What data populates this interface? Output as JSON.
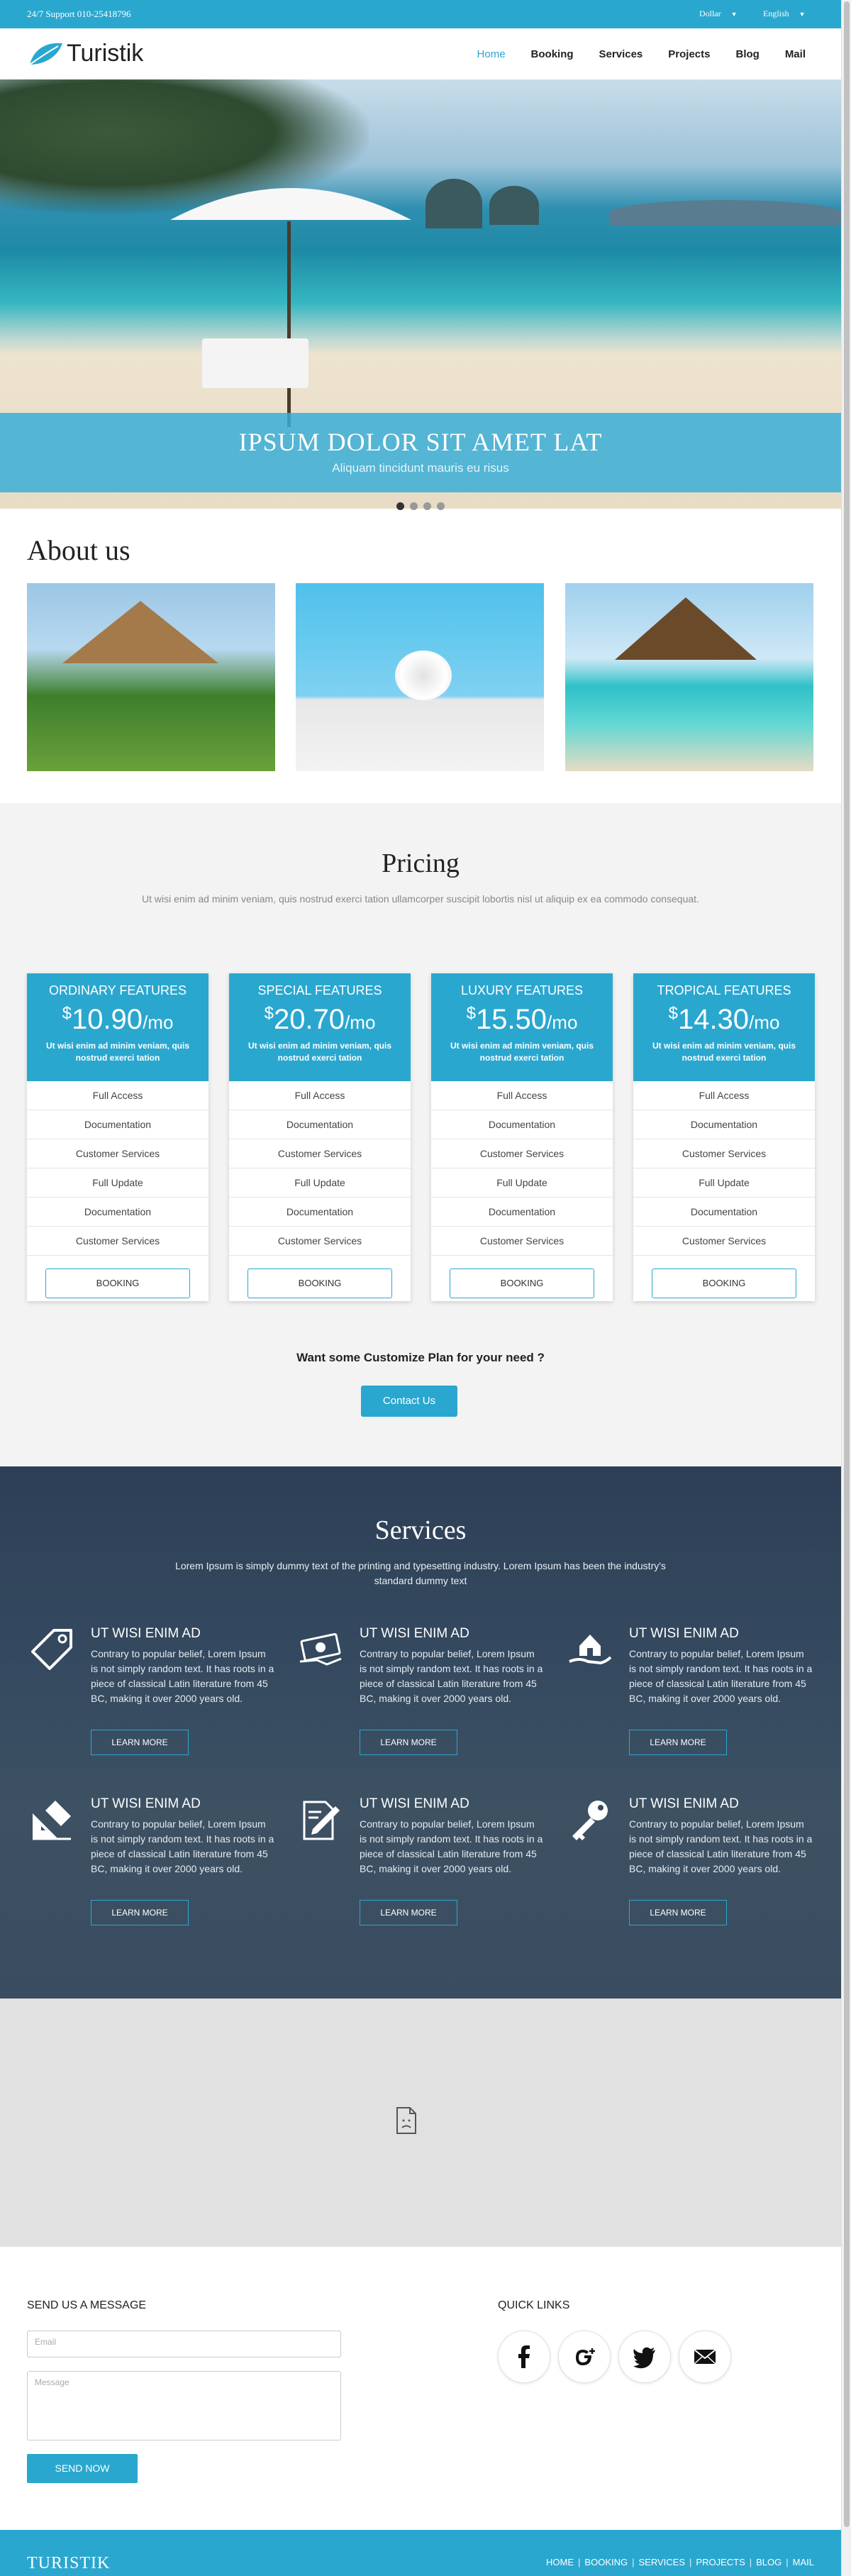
{
  "topbar": {
    "support": "24/7 Support 010-25418796",
    "currency": "Dollar",
    "language": "English"
  },
  "header": {
    "brand": "Turistik",
    "nav": [
      {
        "label": "Home",
        "active": true
      },
      {
        "label": "Booking"
      },
      {
        "label": "Services"
      },
      {
        "label": "Projects"
      },
      {
        "label": "Blog"
      },
      {
        "label": "Mail"
      }
    ]
  },
  "hero": {
    "title": "IPSUM DOLOR SIT AMET LAT",
    "subtitle": "Aliquam tincidunt mauris eu risus",
    "slides": 4,
    "active_slide": 1
  },
  "about": {
    "title": "About us"
  },
  "pricing": {
    "title": "Pricing",
    "subtitle": "Ut wisi enim ad minim veniam, quis nostrud exerci tation ullamcorper suscipit lobortis nisl ut aliquip ex ea commodo consequat.",
    "plans": [
      {
        "name": "ORDINARY FEATURES",
        "currency": "$",
        "amount": "10.90",
        "period": "/mo",
        "desc": "Ut wisi enim ad minim veniam, quis nostrud exerci tation",
        "features": [
          "Full Access",
          "Documentation",
          "Customer Services",
          "Full Update",
          "Documentation",
          "Customer Services"
        ],
        "button": "BOOKING"
      },
      {
        "name": "SPECIAL FEATURES",
        "currency": "$",
        "amount": "20.70",
        "period": "/mo",
        "desc": "Ut wisi enim ad minim veniam, quis nostrud exerci tation",
        "features": [
          "Full Access",
          "Documentation",
          "Customer Services",
          "Full Update",
          "Documentation",
          "Customer Services"
        ],
        "button": "BOOKING"
      },
      {
        "name": "LUXURY FEATURES",
        "currency": "$",
        "amount": "15.50",
        "period": "/mo",
        "desc": "Ut wisi enim ad minim veniam, quis nostrud exerci tation",
        "features": [
          "Full Access",
          "Documentation",
          "Customer Services",
          "Full Update",
          "Documentation",
          "Customer Services"
        ],
        "button": "BOOKING"
      },
      {
        "name": "TROPICAL FEATURES",
        "currency": "$",
        "amount": "14.30",
        "period": "/mo",
        "desc": "Ut wisi enim ad minim veniam, quis nostrud exerci tation",
        "features": [
          "Full Access",
          "Documentation",
          "Customer Services",
          "Full Update",
          "Documentation",
          "Customer Services"
        ],
        "button": "BOOKING"
      }
    ],
    "custom_question": "Want some Customize Plan for your need ?",
    "contact_button": "Contact Us"
  },
  "services": {
    "title": "Services",
    "subtitle": "Lorem Ipsum is simply dummy text of the printing and typesetting industry. Lorem Ipsum has been the industry's standard dummy text",
    "items": [
      {
        "icon": "tag-icon",
        "title": "UT WISI ENIM AD",
        "text": "Contrary to popular belief, Lorem Ipsum is not simply random text. It has roots in a piece of classical Latin literature from 45 BC, making it over 2000 years old.",
        "button": "LEARN MORE"
      },
      {
        "icon": "money-icon",
        "title": "UT WISI ENIM AD",
        "text": "Contrary to popular belief, Lorem Ipsum is not simply random text. It has roots in a piece of classical Latin literature from 45 BC, making it over 2000 years old.",
        "button": "LEARN MORE"
      },
      {
        "icon": "home-hand-icon",
        "title": "UT WISI ENIM AD",
        "text": "Contrary to popular belief, Lorem Ipsum is not simply random text. It has roots in a piece of classical Latin literature from 45 BC, making it over 2000 years old.",
        "button": "LEARN MORE"
      },
      {
        "icon": "blueprint-icon",
        "title": "UT WISI ENIM AD",
        "text": "Contrary to popular belief, Lorem Ipsum is not simply random text. It has roots in a piece of classical Latin literature from 45 BC, making it over 2000 years old.",
        "button": "LEARN MORE"
      },
      {
        "icon": "document-edit-icon",
        "title": "UT WISI ENIM AD",
        "text": "Contrary to popular belief, Lorem Ipsum is not simply random text. It has roots in a piece of classical Latin literature from 45 BC, making it over 2000 years old.",
        "button": "LEARN MORE"
      },
      {
        "icon": "key-icon",
        "title": "UT WISI ENIM AD",
        "text": "Contrary to popular belief, Lorem Ipsum is not simply random text. It has roots in a piece of classical Latin literature from 45 BC, making it over 2000 years old.",
        "button": "LEARN MORE"
      }
    ]
  },
  "contact": {
    "title": "SEND US A MESSAGE",
    "email_placeholder": "Email",
    "message_placeholder": "Message",
    "send_button": "SEND NOW"
  },
  "quick_links": {
    "title": "QUICK LINKS",
    "icons": [
      "facebook-icon",
      "google-plus-icon",
      "twitter-icon",
      "mail-icon"
    ]
  },
  "footer": {
    "brand": "TURISTIK",
    "nav": [
      "HOME",
      "BOOKING",
      "SERVICES",
      "PROJECTS",
      "BLOG",
      "MAIL"
    ]
  },
  "colors": {
    "accent": "#2aa7cf",
    "services_bg": "#34495f"
  }
}
